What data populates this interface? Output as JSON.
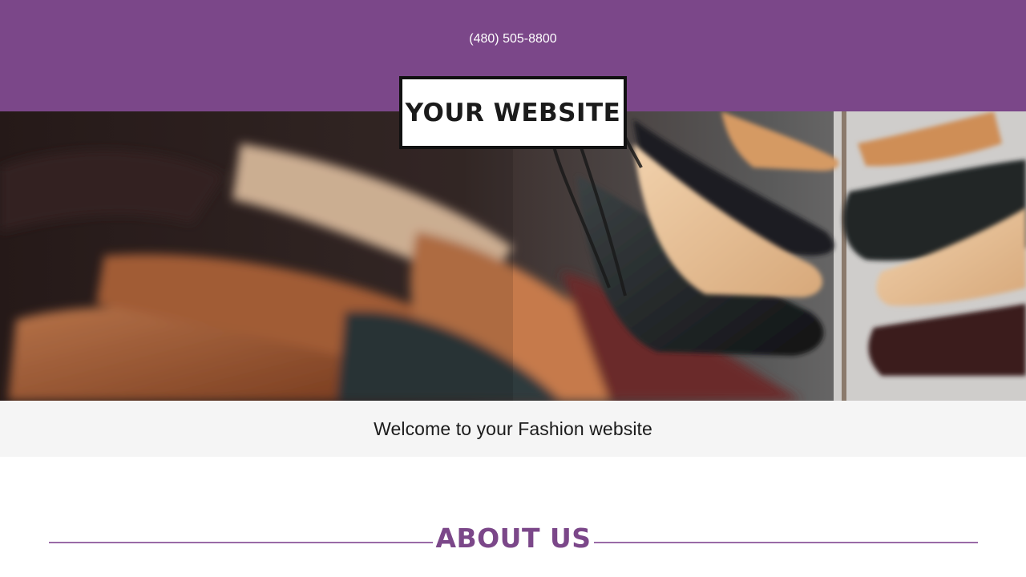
{
  "header": {
    "phone": "(480) 505-8800",
    "background_color": "#7b4789"
  },
  "logo": {
    "text": "YOUR WEBSITE"
  },
  "hero": {
    "image": "shoes-photo"
  },
  "welcome": {
    "text": "Welcome to your Fashion website"
  },
  "about": {
    "title": "ABOUT US",
    "accent_color": "#7b4789"
  }
}
